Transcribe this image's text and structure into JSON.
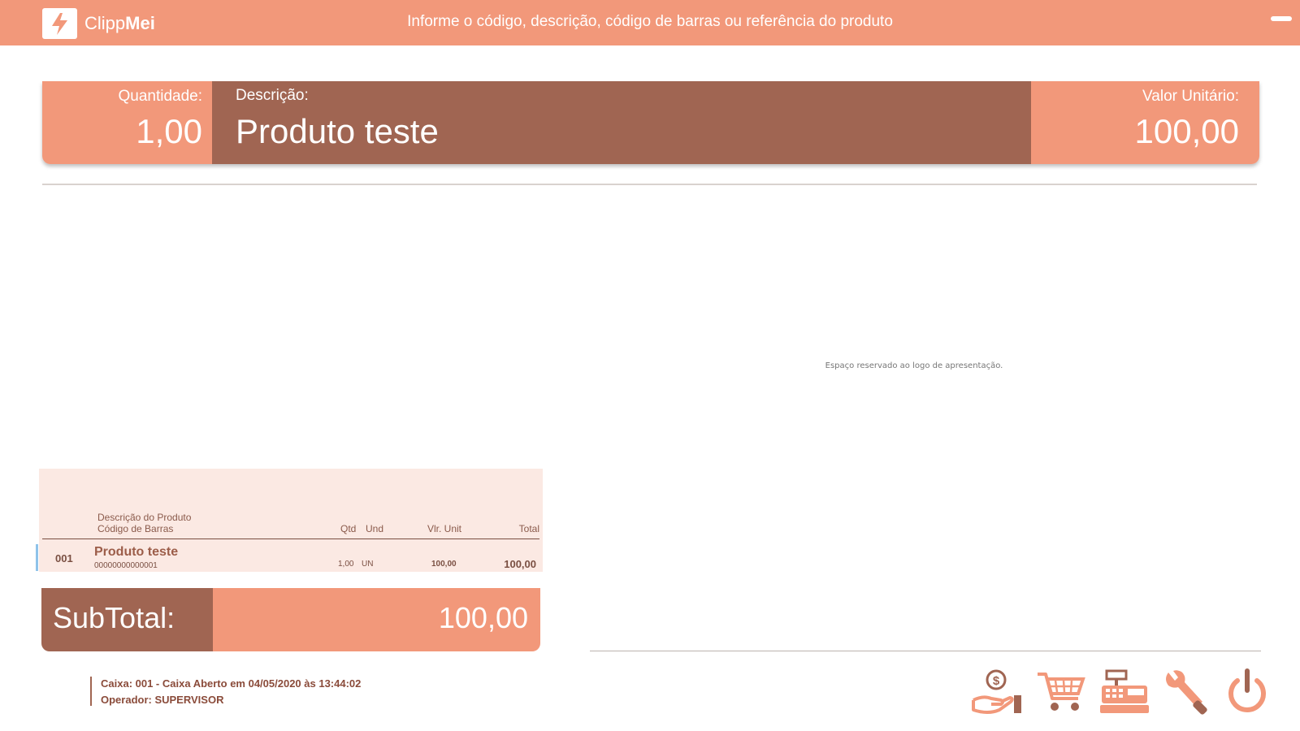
{
  "header": {
    "brand_light": "Clipp",
    "brand_bold": "Mei",
    "hint": "Informe o código, descrição, código de barras ou referência do produto"
  },
  "current_product": {
    "quantity_label": "Quantidade:",
    "quantity_value": "1,00",
    "description_label": "Descrição:",
    "description_value": "Produto teste",
    "unit_value_label": "Valor Unitário:",
    "unit_value": "100,00"
  },
  "logo_placeholder": "Espaço reservado ao logo de apresentação.",
  "items_table": {
    "headers": {
      "desc_line1": "Descrição do Produto",
      "desc_line2": "Código de Barras",
      "qtd": "Qtd",
      "und": "Und",
      "vlr_unit": "Vlr. Unit",
      "total": "Total"
    },
    "rows": [
      {
        "num": "001",
        "description": "Produto teste",
        "barcode": "00000000000001",
        "qtd": "1,00",
        "und": "UN",
        "vlr_unit": "100,00",
        "total": "100,00"
      }
    ]
  },
  "subtotal": {
    "label": "SubTotal:",
    "value": "100,00"
  },
  "status": {
    "line1": "Caixa: 001 - Caixa Aberto em 04/05/2020 às 13:44:02",
    "line2": "Operador: SUPERVISOR"
  },
  "colors": {
    "accent": "#f2987a",
    "dark": "#a06552",
    "table_bg": "#fbe9e3"
  },
  "actions": [
    "money-hand-icon",
    "cart-icon",
    "cash-register-icon",
    "wrench-icon",
    "power-icon"
  ]
}
